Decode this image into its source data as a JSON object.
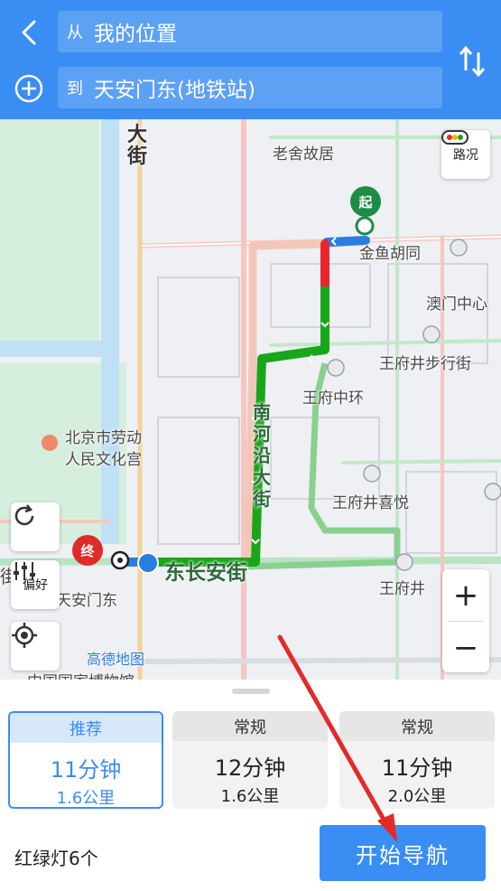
{
  "header": {
    "from_prefix": "从",
    "from_value": "我的位置",
    "to_prefix": "到",
    "to_value": "天安门东(地铁站)"
  },
  "map": {
    "labels": {
      "laoshe": "老舍故居",
      "jinyu": "金鱼胡同",
      "aomen": "澳门中心",
      "wangfujing_walk": "王府井步行街",
      "wangfujing_center": "王府中环",
      "laodong": "北京市劳动",
      "renmin": "人民文化宫",
      "xiyue": "王府井喜悦",
      "wangfujing": "王府井",
      "tiananmen_east": "天安门东",
      "museum": "中国国家博物馆",
      "dajie": "大街",
      "nanheyan": "南河沿大街",
      "changan": "东长安街",
      "jie_left": "街",
      "jie_top": "大街",
      "gaode": "高德地图"
    },
    "start_pin": "起",
    "end_pin": "终",
    "traffic_label": "路况",
    "preference_label": "偏好",
    "zoom_in": "+",
    "zoom_out": "−"
  },
  "routes": [
    {
      "tag": "推荐",
      "time": "11分钟",
      "distance": "1.6公里",
      "selected": true
    },
    {
      "tag": "常规",
      "time": "12分钟",
      "distance": "1.6公里",
      "selected": false
    },
    {
      "tag": "常规",
      "time": "11分钟",
      "distance": "2.0公里",
      "selected": false
    }
  ],
  "footer": {
    "traffic_lights": "红绿灯6个",
    "start_button": "开始导航"
  },
  "colors": {
    "accent": "#3a8df2",
    "route_green": "#1aa61a",
    "route_red": "#e8262c",
    "annotation_arrow": "#e12b2b"
  }
}
